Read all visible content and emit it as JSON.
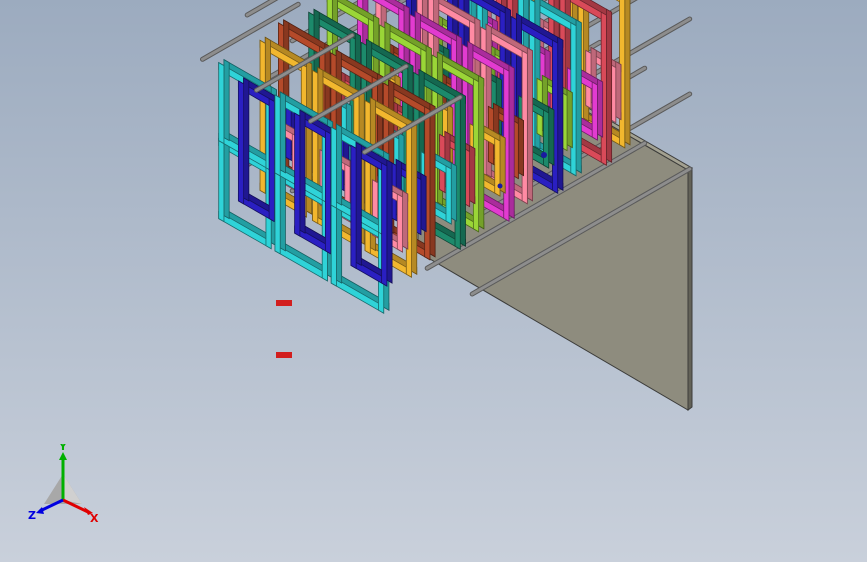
{
  "viewport": {
    "background_top": "#9cabbf",
    "background_bottom": "#c9d0db"
  },
  "model": {
    "wall_color": "#8e8c7e",
    "wall_edge_color": "#3c3c3a",
    "rod_color": "#8d8d8d",
    "frame_colors": [
      "#2fd3d8",
      "#2a1fc2",
      "#ff8aa3",
      "#e23bd0",
      "#9ad637",
      "#1c8a6b",
      "#b54a2a",
      "#f2b72e",
      "#d94a59"
    ]
  },
  "triad": {
    "icon": "axis-triad-icon",
    "x_label": "X",
    "y_label": "Y",
    "z_label": "Z",
    "x_color": "#e00000",
    "y_color": "#00b000",
    "z_color": "#0000e0"
  }
}
